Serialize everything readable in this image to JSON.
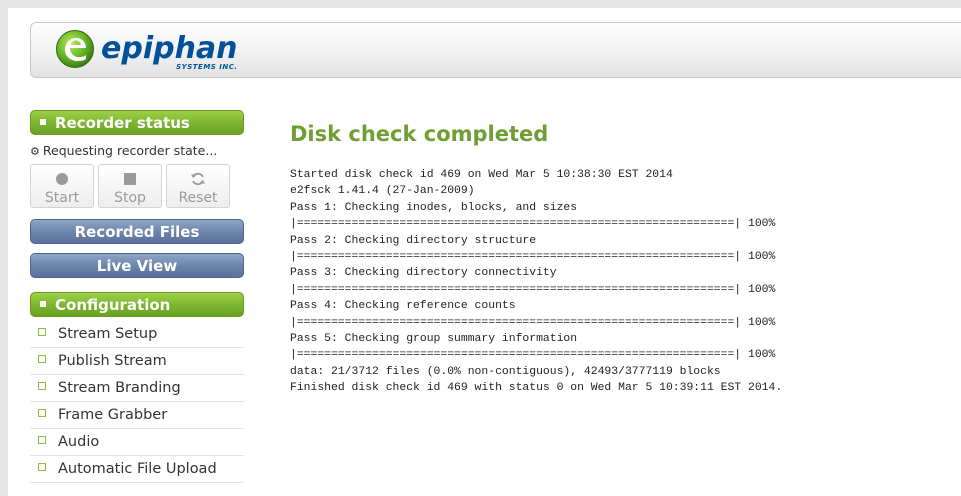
{
  "header": {
    "logo_text": "epiphan",
    "logo_subtext": "SYSTEMS INC.",
    "brand_color": "#00509a"
  },
  "sidebar": {
    "recorder_status_title": "Recorder status",
    "recorder_state_text": "Requesting recorder state...",
    "controls": [
      {
        "label": "Start",
        "icon": "circle-icon"
      },
      {
        "label": "Stop",
        "icon": "square-icon"
      },
      {
        "label": "Reset",
        "icon": "refresh-icon"
      }
    ],
    "recorded_files_label": "Recorded Files",
    "live_view_label": "Live View",
    "configuration_title": "Configuration",
    "config_items": [
      "Stream Setup",
      "Publish Stream",
      "Stream Branding",
      "Frame Grabber",
      "Audio",
      "Automatic File Upload"
    ]
  },
  "main": {
    "title": "Disk check completed",
    "log_lines": [
      "Started disk check id 469 on Wed Mar 5 10:38:30 EST 2014",
      "e2fsck 1.41.4 (27-Jan-2009)",
      "Pass 1: Checking inodes, blocks, and sizes",
      "|================================================================| 100%",
      "Pass 2: Checking directory structure",
      "|================================================================| 100%",
      "Pass 3: Checking directory connectivity",
      "|================================================================| 100%",
      "Pass 4: Checking reference counts",
      "|================================================================| 100%",
      "Pass 5: Checking group summary information",
      "|================================================================| 100%",
      "data: 21/3712 files (0.0% non-contiguous), 42493/3777119 blocks",
      "Finished disk check id 469 with status 0 on Wed Mar 5 10:39:11 EST 2014."
    ]
  },
  "colors": {
    "accent_green": "#7cb32f",
    "title_green": "#6f9e32",
    "nav_blue": "#6b83ab"
  }
}
